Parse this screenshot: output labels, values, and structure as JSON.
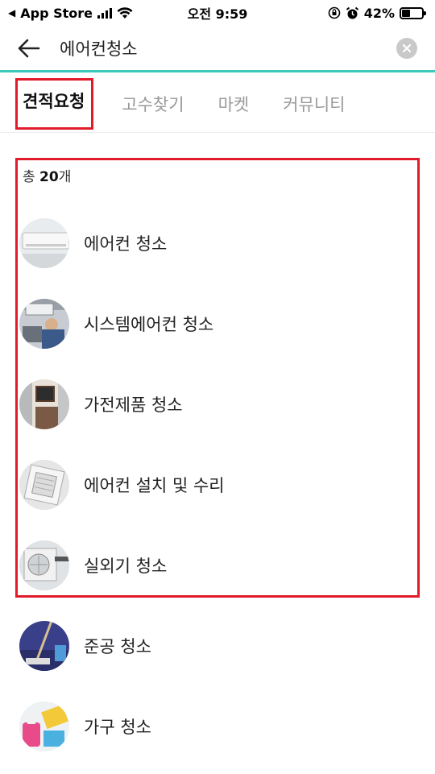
{
  "status_bar": {
    "back_app": "App Store",
    "time": "오전 9:59",
    "battery_percent": "42%",
    "battery_level": 0.42
  },
  "search": {
    "query": "에어컨청소"
  },
  "tabs": [
    {
      "label": "견적요청",
      "active": true
    },
    {
      "label": "고수찾기",
      "active": false
    },
    {
      "label": "마켓",
      "active": false
    },
    {
      "label": "커뮤니티",
      "active": false
    }
  ],
  "results": {
    "count_prefix": "총 ",
    "count_value": "20",
    "count_suffix": "개",
    "items": [
      {
        "label": "에어컨 청소",
        "thumb": "wall-ac"
      },
      {
        "label": "시스템에어컨 청소",
        "thumb": "technician"
      },
      {
        "label": "가전제품 청소",
        "thumb": "kitchen"
      },
      {
        "label": "에어컨 설치 및 수리",
        "thumb": "ceiling-ac"
      },
      {
        "label": "실외기 청소",
        "thumb": "outdoor-unit"
      },
      {
        "label": "준공 청소",
        "thumb": "mop"
      },
      {
        "label": "가구 청소",
        "thumb": "spray-cleaning"
      }
    ]
  },
  "colors": {
    "accent_line": "#3ec9bd",
    "highlight_box": "#e11b2a"
  }
}
